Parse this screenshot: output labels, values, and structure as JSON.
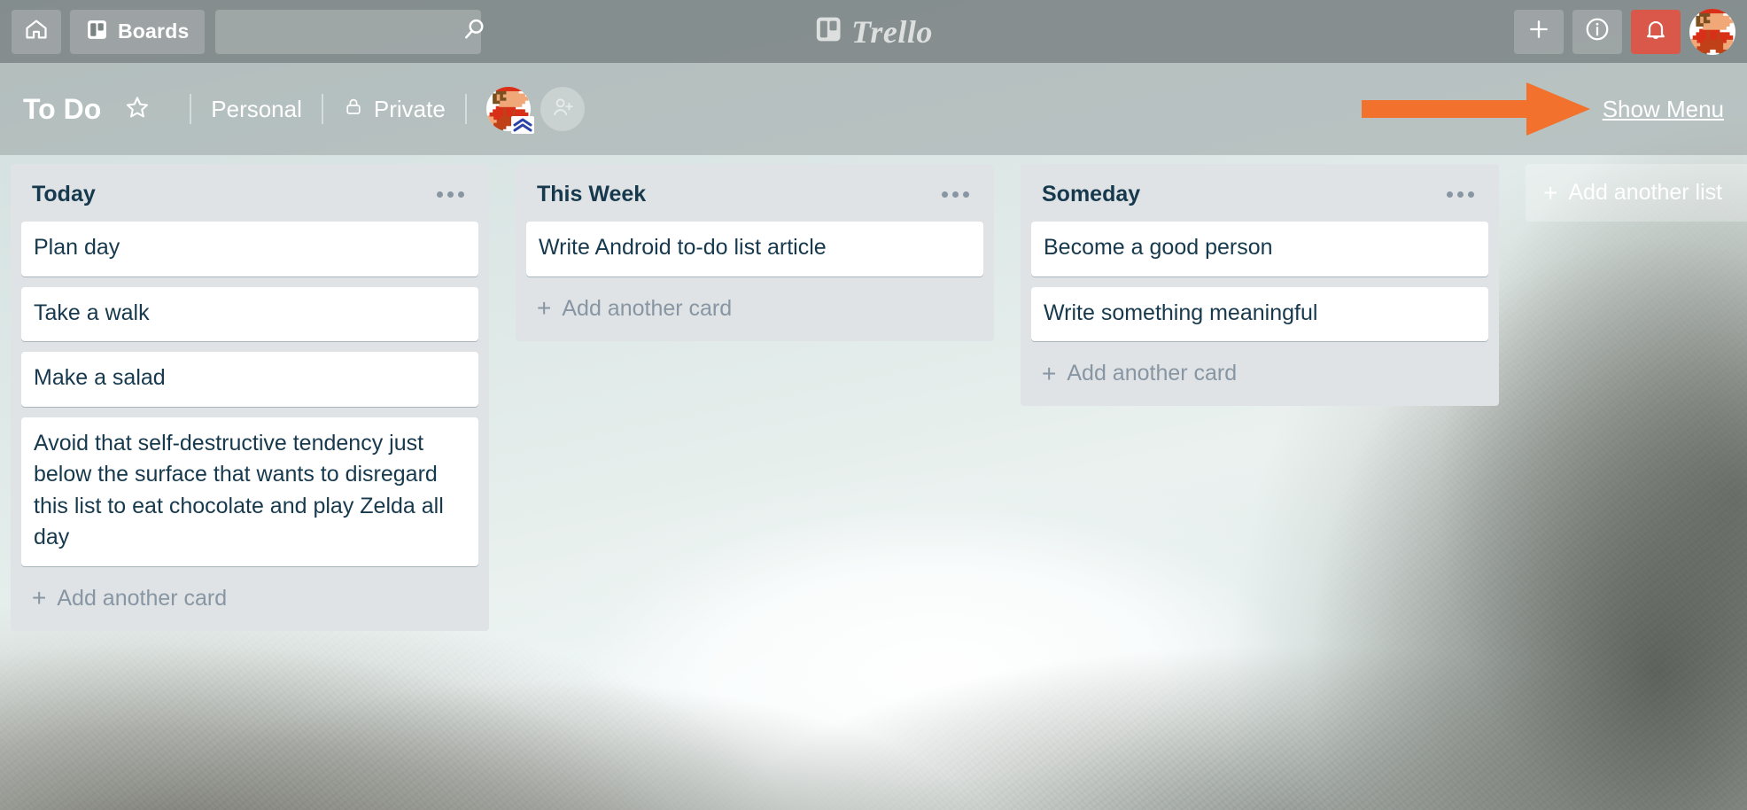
{
  "app": {
    "name": "Trello",
    "accent_notification_color": "#d9584a",
    "arrow_color": "#f2712c",
    "list_bg_color": "#dfe3e6",
    "card_text_color": "#17394d"
  },
  "top_header": {
    "home_icon": "home-icon",
    "boards_label": "Boards",
    "boards_icon": "boards-icon",
    "search": {
      "value": "",
      "placeholder": "",
      "icon": "search-icon"
    },
    "logo_text": "Trello",
    "logo_icon": "trello-board-icon",
    "actions": [
      {
        "name": "add-button",
        "icon": "plus-icon",
        "label": "+"
      },
      {
        "name": "info-button",
        "icon": "info-icon",
        "label": "i"
      },
      {
        "name": "notifications-button",
        "icon": "bell-icon",
        "label": ""
      }
    ],
    "avatar": {
      "name": "user-avatar",
      "icon": "mario-avatar"
    }
  },
  "board_header": {
    "title": "To Do",
    "star_icon": "star-icon",
    "team": "Personal",
    "visibility": "Private",
    "visibility_icon": "lock-icon",
    "member_avatar": "mario-avatar",
    "admin_badge_icon": "double-chevron-up-icon",
    "add_member_icon": "person-add-icon",
    "show_menu_label": "Show Menu",
    "arrow_icon": "right-arrow-annotation"
  },
  "lists": [
    {
      "title": "Today",
      "menu_icon": "list-menu-icon",
      "add_card_label": "Add another card",
      "cards": [
        {
          "text": "Plan day"
        },
        {
          "text": "Take a walk"
        },
        {
          "text": "Make a salad"
        },
        {
          "text": "Avoid that self-destructive tendency just below the surface that wants to disregard this list to eat chocolate and play Zelda all day"
        }
      ]
    },
    {
      "title": "This Week",
      "menu_icon": "list-menu-icon",
      "add_card_label": "Add another card",
      "cards": [
        {
          "text": "Write Android to-do list article"
        }
      ]
    },
    {
      "title": "Someday",
      "menu_icon": "list-menu-icon",
      "add_card_label": "Add another card",
      "cards": [
        {
          "text": "Become a good person"
        },
        {
          "text": "Write something meaningful"
        }
      ]
    }
  ],
  "add_list": {
    "label": "Add another list",
    "plus": "+"
  },
  "glyphs": {
    "plus": "+"
  }
}
